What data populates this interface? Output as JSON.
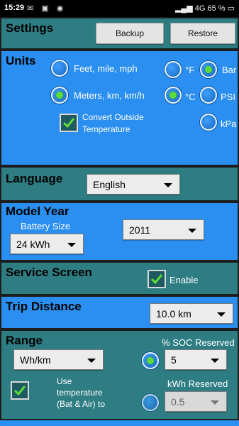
{
  "status_bar": {
    "time": "15:29",
    "right": "4G 65 %"
  },
  "settings": {
    "title": "Settings",
    "backup_label": "Backup",
    "restore_label": "Restore"
  },
  "units": {
    "title": "Units",
    "feet_label": "Feet, mile, mph",
    "meters_label": "Meters, km, km/h",
    "fahrenheit_label": "°F",
    "celsius_label": "°C",
    "bar_label": "Bar",
    "psi_label": "PSI",
    "kpa_label": "kPa",
    "convert_label_1": "Convert Outside",
    "convert_label_2": "Temperature",
    "distance_selected": "Meters, km, km/h",
    "temperature_selected": "°C",
    "pressure_selected": "Bar",
    "convert_checked": true
  },
  "language": {
    "title": "Language",
    "value": "English"
  },
  "model_year": {
    "title": "Model Year",
    "battery_label": "Battery Size",
    "battery_value": "24 kWh",
    "year_value": "2011"
  },
  "service_screen": {
    "title": "Service Screen",
    "enable_label": "Enable",
    "enabled": true
  },
  "trip_distance": {
    "title": "Trip Distance",
    "value": "10.0 km"
  },
  "range": {
    "title": "Range",
    "unit_value": "Wh/km",
    "soc_label": "% SOC Reserved",
    "soc_value": "5",
    "kwh_label": "kWh Reserved",
    "kwh_value": "0.5",
    "use_temp_1": "Use",
    "use_temp_2": "temperature",
    "use_temp_3": "(Bat & Air) to",
    "use_temp_checked": true,
    "soc_selected": true
  },
  "colors": {
    "teal": "#2e7d83",
    "blue": "#2a8ff0",
    "radio_on": "#5cdc3a"
  }
}
